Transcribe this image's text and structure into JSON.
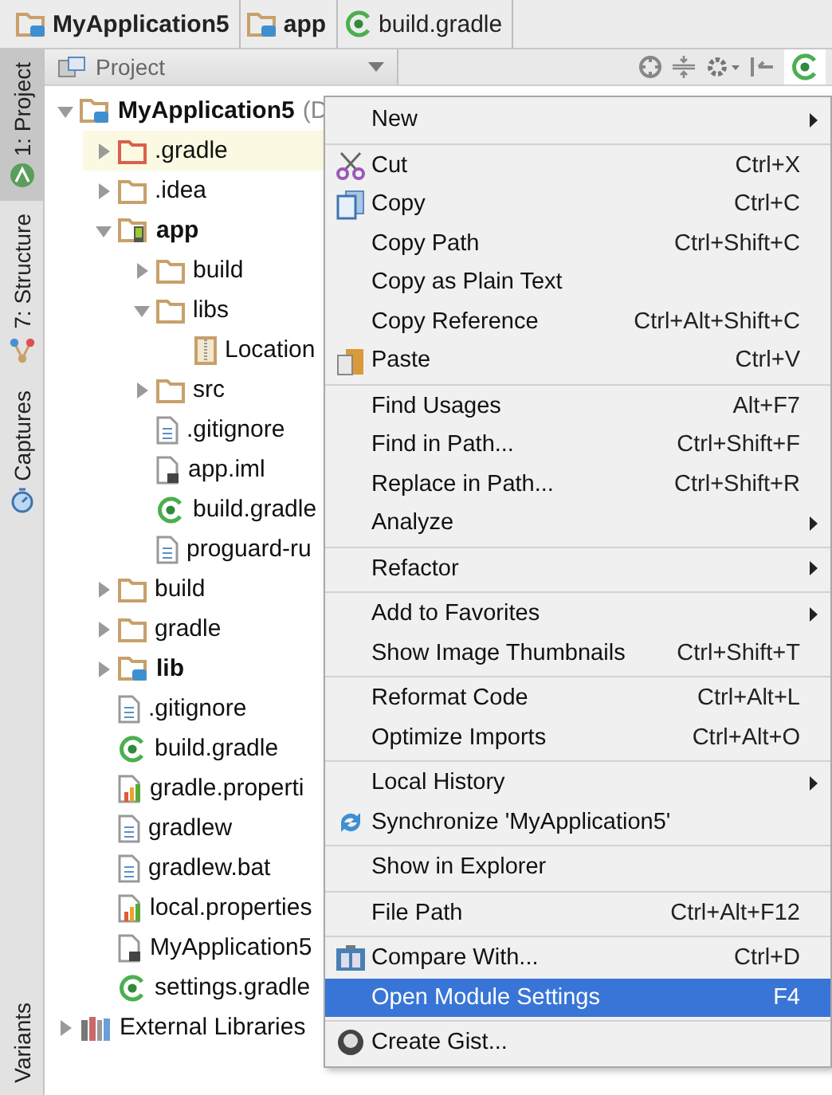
{
  "breadcrumbs": [
    {
      "label": "MyApplication5",
      "kind": "module",
      "bold": true
    },
    {
      "label": "app",
      "kind": "module",
      "bold": true
    },
    {
      "label": "build.gradle",
      "kind": "gradle",
      "bold": false
    }
  ],
  "side_tabs": [
    {
      "label": "1: Project",
      "kind": "android",
      "selected": true
    },
    {
      "label": "7: Structure",
      "kind": "structure",
      "selected": false
    },
    {
      "label": "Captures",
      "kind": "captures",
      "selected": false
    }
  ],
  "side_tabs_bottom": [
    {
      "label": "Variants",
      "selected": false
    }
  ],
  "toolbar": {
    "view": "Project"
  },
  "tree": [
    {
      "label": "MyApplication5",
      "note": "(D",
      "kind": "module",
      "bold": true,
      "selected": false,
      "expanded": true,
      "children": [
        {
          "label": ".gradle",
          "kind": "folder-excluded",
          "bold": false,
          "selected": true,
          "expanded": false
        },
        {
          "label": ".idea",
          "kind": "folder",
          "bold": false,
          "selected": false,
          "expanded": false
        },
        {
          "label": "app",
          "kind": "android-module",
          "bold": true,
          "selected": false,
          "expanded": true,
          "children": [
            {
              "label": "build",
              "kind": "folder",
              "bold": false,
              "selected": false,
              "expanded": false
            },
            {
              "label": "libs",
              "kind": "folder",
              "bold": false,
              "selected": false,
              "expanded": true,
              "children": [
                {
                  "label": "Location",
                  "kind": "jar",
                  "bold": false,
                  "selected": false
                }
              ]
            },
            {
              "label": "src",
              "kind": "folder",
              "bold": false,
              "selected": false,
              "expanded": false
            },
            {
              "label": ".gitignore",
              "kind": "text",
              "bold": false,
              "selected": false
            },
            {
              "label": "app.iml",
              "kind": "iml",
              "bold": false,
              "selected": false
            },
            {
              "label": "build.gradle",
              "kind": "gradle",
              "bold": false,
              "selected": false
            },
            {
              "label": "proguard-ru",
              "kind": "text",
              "bold": false,
              "selected": false
            }
          ]
        },
        {
          "label": "build",
          "kind": "folder",
          "bold": false,
          "selected": false,
          "expanded": false
        },
        {
          "label": "gradle",
          "kind": "folder",
          "bold": false,
          "selected": false,
          "expanded": false
        },
        {
          "label": "lib",
          "kind": "module",
          "bold": true,
          "selected": false,
          "expanded": false
        },
        {
          "label": ".gitignore",
          "kind": "text",
          "bold": false,
          "selected": false
        },
        {
          "label": "build.gradle",
          "kind": "gradle",
          "bold": false,
          "selected": false
        },
        {
          "label": "gradle.properti",
          "kind": "properties",
          "bold": false,
          "selected": false
        },
        {
          "label": "gradlew",
          "kind": "text",
          "bold": false,
          "selected": false
        },
        {
          "label": "gradlew.bat",
          "kind": "text",
          "bold": false,
          "selected": false
        },
        {
          "label": "local.properties",
          "kind": "properties",
          "bold": false,
          "selected": false
        },
        {
          "label": "MyApplication5",
          "kind": "iml",
          "bold": false,
          "selected": false
        },
        {
          "label": "settings.gradle",
          "kind": "gradle",
          "bold": false,
          "selected": false
        }
      ]
    },
    {
      "label": "External Libraries",
      "kind": "library",
      "bold": false,
      "selected": false,
      "expanded": false
    }
  ],
  "context_menu": [
    [
      {
        "label": "New",
        "kind": "plain",
        "submenu": true,
        "selected": false
      }
    ],
    [
      {
        "label": "Cut",
        "shortcut": "Ctrl+X",
        "kind": "cut",
        "submenu": false,
        "selected": false
      },
      {
        "label": "Copy",
        "shortcut": "Ctrl+C",
        "kind": "copy",
        "submenu": false,
        "selected": false
      },
      {
        "label": "Copy Path",
        "shortcut": "Ctrl+Shift+C",
        "kind": "plain",
        "submenu": false,
        "selected": false
      },
      {
        "label": "Copy as Plain Text",
        "kind": "plain",
        "submenu": false,
        "selected": false
      },
      {
        "label": "Copy Reference",
        "shortcut": "Ctrl+Alt+Shift+C",
        "kind": "plain",
        "submenu": false,
        "selected": false
      },
      {
        "label": "Paste",
        "shortcut": "Ctrl+V",
        "kind": "paste",
        "submenu": false,
        "selected": false
      }
    ],
    [
      {
        "label": "Find Usages",
        "shortcut": "Alt+F7",
        "kind": "plain",
        "submenu": false,
        "selected": false
      },
      {
        "label": "Find in Path...",
        "shortcut": "Ctrl+Shift+F",
        "kind": "plain",
        "submenu": false,
        "selected": false
      },
      {
        "label": "Replace in Path...",
        "shortcut": "Ctrl+Shift+R",
        "kind": "plain",
        "submenu": false,
        "selected": false
      },
      {
        "label": "Analyze",
        "kind": "plain",
        "submenu": true,
        "selected": false
      }
    ],
    [
      {
        "label": "Refactor",
        "kind": "plain",
        "submenu": true,
        "selected": false
      }
    ],
    [
      {
        "label": "Add to Favorites",
        "kind": "plain",
        "submenu": true,
        "selected": false
      },
      {
        "label": "Show Image Thumbnails",
        "shortcut": "Ctrl+Shift+T",
        "kind": "plain",
        "submenu": false,
        "selected": false
      }
    ],
    [
      {
        "label": "Reformat Code",
        "shortcut": "Ctrl+Alt+L",
        "kind": "plain",
        "submenu": false,
        "selected": false
      },
      {
        "label": "Optimize Imports",
        "shortcut": "Ctrl+Alt+O",
        "kind": "plain",
        "submenu": false,
        "selected": false
      }
    ],
    [
      {
        "label": "Local History",
        "kind": "plain",
        "submenu": true,
        "selected": false
      },
      {
        "label": "Synchronize 'MyApplication5'",
        "kind": "sync",
        "submenu": false,
        "selected": false
      }
    ],
    [
      {
        "label": "Show in Explorer",
        "kind": "plain",
        "submenu": false,
        "selected": false
      }
    ],
    [
      {
        "label": "File Path",
        "shortcut": "Ctrl+Alt+F12",
        "kind": "plain",
        "submenu": false,
        "selected": false
      }
    ],
    [
      {
        "label": "Compare With...",
        "shortcut": "Ctrl+D",
        "kind": "compare",
        "submenu": false,
        "selected": false
      },
      {
        "label": "Open Module Settings",
        "shortcut": "F4",
        "kind": "plain",
        "submenu": false,
        "selected": true
      }
    ],
    [
      {
        "label": "Create Gist...",
        "kind": "gist",
        "submenu": false,
        "selected": false
      }
    ]
  ]
}
